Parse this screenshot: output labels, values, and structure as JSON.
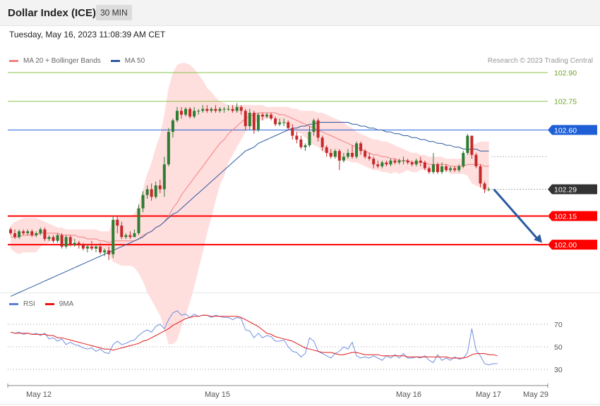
{
  "header": {
    "title": "Dollar Index (ICE)",
    "timeframe": "30 MIN"
  },
  "date": "Tuesday, May 16, 2023 11:08:39 AM CET",
  "legend": {
    "ma20": "MA 20 + Bollinger Bands",
    "ma50": "MA 50",
    "credit": "Research © 2023 Trading Central"
  },
  "rsi_legend": {
    "rsi": "RSI",
    "ma9": "9MA"
  },
  "colors": {
    "up": "#2e7d32",
    "down": "#c62828",
    "band_fill": "#ffdede",
    "ma20": "#f08080",
    "ma50": "#2c5aa0",
    "support": "#ff0000",
    "resistance": "#8bc34a",
    "pivot": "#1f5fd6",
    "arrow": "#2c5aa0"
  },
  "chart_data": {
    "type": "candlestick",
    "price_axis": {
      "ylim": [
        101.68,
        102.97
      ]
    },
    "x_labels": [
      "May 12",
      "May 15",
      "May 16",
      "May 17",
      "May 29"
    ],
    "levels": [
      {
        "value": 102.9,
        "label": "102.90",
        "kind": "resistance"
      },
      {
        "value": 102.75,
        "label": "102.75",
        "kind": "resistance"
      },
      {
        "value": 102.6,
        "label": "102.60",
        "kind": "pivot"
      },
      {
        "value": 102.29,
        "label": "102.29",
        "kind": "last"
      },
      {
        "value": 102.15,
        "label": "102.15",
        "kind": "support"
      },
      {
        "value": 102.0,
        "label": "102.00",
        "kind": "support"
      }
    ],
    "forecast_arrow": {
      "from": 102.29,
      "to": 102.01
    },
    "candles": [
      [
        102.08,
        102.06,
        102.09,
        102.05
      ],
      [
        102.06,
        102.04,
        102.08,
        102.03
      ],
      [
        102.04,
        102.07,
        102.08,
        102.03
      ],
      [
        102.07,
        102.06,
        102.08,
        102.05
      ],
      [
        102.06,
        102.07,
        102.08,
        102.05
      ],
      [
        102.07,
        102.05,
        102.08,
        102.04
      ],
      [
        102.05,
        102.06,
        102.07,
        102.04
      ],
      [
        102.06,
        102.08,
        102.09,
        102.05
      ],
      [
        102.08,
        102.03,
        102.09,
        102.02
      ],
      [
        102.03,
        102.04,
        102.05,
        102.02
      ],
      [
        102.04,
        102.02,
        102.05,
        102.01
      ],
      [
        102.02,
        102.05,
        102.06,
        102.01
      ],
      [
        102.05,
        101.99,
        102.06,
        101.98
      ],
      [
        101.99,
        102.04,
        102.05,
        101.98
      ],
      [
        102.04,
        102.0,
        102.05,
        101.99
      ],
      [
        102.0,
        102.01,
        102.03,
        101.99
      ],
      [
        102.01,
        102.0,
        102.02,
        101.98
      ],
      [
        102.0,
        101.98,
        102.01,
        101.97
      ],
      [
        101.98,
        101.99,
        102.0,
        101.96
      ],
      [
        101.99,
        101.98,
        102.02,
        101.97
      ],
      [
        101.98,
        101.99,
        102.0,
        101.96
      ],
      [
        101.99,
        101.96,
        102.01,
        101.95
      ],
      [
        101.96,
        101.97,
        101.98,
        101.94
      ],
      [
        101.97,
        101.95,
        101.99,
        101.92
      ],
      [
        101.95,
        102.13,
        102.15,
        101.93
      ],
      [
        102.13,
        102.1,
        102.15,
        102.06
      ],
      [
        102.1,
        102.04,
        102.12,
        102.03
      ],
      [
        102.04,
        102.05,
        102.06,
        102.03
      ],
      [
        102.05,
        102.04,
        102.07,
        102.03
      ],
      [
        102.04,
        102.06,
        102.08,
        102.04
      ],
      [
        102.06,
        102.19,
        102.21,
        102.05
      ],
      [
        102.19,
        102.26,
        102.28,
        102.17
      ],
      [
        102.26,
        102.29,
        102.31,
        102.24
      ],
      [
        102.29,
        102.25,
        102.32,
        102.23
      ],
      [
        102.25,
        102.31,
        102.33,
        102.24
      ],
      [
        102.31,
        102.29,
        102.34,
        102.27
      ],
      [
        102.29,
        102.42,
        102.46,
        102.25
      ],
      [
        102.42,
        102.59,
        102.61,
        102.41
      ],
      [
        102.59,
        102.65,
        102.66,
        102.56
      ],
      [
        102.65,
        102.7,
        102.72,
        102.64
      ],
      [
        102.7,
        102.68,
        102.72,
        102.66
      ],
      [
        102.68,
        102.71,
        102.72,
        102.67
      ],
      [
        102.71,
        102.67,
        102.72,
        102.66
      ],
      [
        102.67,
        102.7,
        102.72,
        102.66
      ],
      [
        102.7,
        102.7,
        102.71,
        102.68
      ],
      [
        102.7,
        102.71,
        102.73,
        102.69
      ],
      [
        102.71,
        102.7,
        102.73,
        102.69
      ],
      [
        102.7,
        102.71,
        102.72,
        102.69
      ],
      [
        102.71,
        102.7,
        102.73,
        102.69
      ],
      [
        102.7,
        102.71,
        102.72,
        102.69
      ],
      [
        102.71,
        102.71,
        102.72,
        102.69
      ],
      [
        102.71,
        102.71,
        102.73,
        102.7
      ],
      [
        102.71,
        102.7,
        102.73,
        102.69
      ],
      [
        102.7,
        102.72,
        102.74,
        102.69
      ],
      [
        102.72,
        102.7,
        102.73,
        102.68
      ],
      [
        102.7,
        102.62,
        102.71,
        102.6
      ],
      [
        102.62,
        102.69,
        102.71,
        102.6
      ],
      [
        102.69,
        102.6,
        102.7,
        102.58
      ],
      [
        102.6,
        102.68,
        102.69,
        102.59
      ],
      [
        102.68,
        102.67,
        102.69,
        102.65
      ],
      [
        102.67,
        102.68,
        102.69,
        102.66
      ],
      [
        102.68,
        102.66,
        102.69,
        102.65
      ],
      [
        102.66,
        102.63,
        102.67,
        102.62
      ],
      [
        102.63,
        102.64,
        102.66,
        102.62
      ],
      [
        102.64,
        102.64,
        102.66,
        102.62
      ],
      [
        102.64,
        102.61,
        102.65,
        102.6
      ],
      [
        102.61,
        102.57,
        102.63,
        102.55
      ],
      [
        102.57,
        102.55,
        102.59,
        102.53
      ],
      [
        102.55,
        102.51,
        102.57,
        102.5
      ],
      [
        102.51,
        102.52,
        102.53,
        102.49
      ],
      [
        102.52,
        102.59,
        102.62,
        102.51
      ],
      [
        102.59,
        102.65,
        102.66,
        102.57
      ],
      [
        102.65,
        102.56,
        102.66,
        102.54
      ],
      [
        102.56,
        102.51,
        102.57,
        102.49
      ],
      [
        102.51,
        102.48,
        102.52,
        102.46
      ],
      [
        102.48,
        102.46,
        102.5,
        102.45
      ],
      [
        102.46,
        102.49,
        102.5,
        102.45
      ],
      [
        102.49,
        102.44,
        102.5,
        102.39
      ],
      [
        102.44,
        102.46,
        102.48,
        102.43
      ],
      [
        102.46,
        102.48,
        102.5,
        102.45
      ],
      [
        102.48,
        102.46,
        102.52,
        102.45
      ],
      [
        102.46,
        102.53,
        102.54,
        102.45
      ],
      [
        102.53,
        102.49,
        102.54,
        102.47
      ],
      [
        102.49,
        102.46,
        102.5,
        102.45
      ],
      [
        102.46,
        102.45,
        102.48,
        102.44
      ],
      [
        102.45,
        102.42,
        102.46,
        102.4
      ],
      [
        102.42,
        102.41,
        102.44,
        102.4
      ],
      [
        102.41,
        102.43,
        102.44,
        102.4
      ],
      [
        102.43,
        102.42,
        102.44,
        102.41
      ],
      [
        102.42,
        102.44,
        102.45,
        102.41
      ],
      [
        102.44,
        102.43,
        102.45,
        102.42
      ],
      [
        102.43,
        102.44,
        102.45,
        102.42
      ],
      [
        102.44,
        102.44,
        102.46,
        102.42
      ],
      [
        102.44,
        102.43,
        102.45,
        102.42
      ],
      [
        102.43,
        102.42,
        102.44,
        102.41
      ],
      [
        102.42,
        102.44,
        102.45,
        102.41
      ],
      [
        102.44,
        102.43,
        102.46,
        102.41
      ],
      [
        102.43,
        102.4,
        102.44,
        102.39
      ],
      [
        102.4,
        102.38,
        102.41,
        102.37
      ],
      [
        102.38,
        102.42,
        102.48,
        102.37
      ],
      [
        102.42,
        102.38,
        102.43,
        102.37
      ],
      [
        102.38,
        102.41,
        102.43,
        102.37
      ],
      [
        102.41,
        102.39,
        102.42,
        102.38
      ],
      [
        102.39,
        102.4,
        102.41,
        102.38
      ],
      [
        102.4,
        102.39,
        102.41,
        102.38
      ],
      [
        102.39,
        102.41,
        102.42,
        102.38
      ],
      [
        102.41,
        102.48,
        102.49,
        102.4
      ],
      [
        102.48,
        102.57,
        102.58,
        102.47
      ],
      [
        102.57,
        102.47,
        102.57,
        102.45
      ],
      [
        102.47,
        102.41,
        102.48,
        102.4
      ],
      [
        102.41,
        102.32,
        102.42,
        102.3
      ],
      [
        102.32,
        102.29,
        102.33,
        102.27
      ],
      [
        102.29,
        102.29,
        102.3,
        102.28
      ]
    ],
    "ma20": [
      102.04,
      102.04,
      102.04,
      102.05,
      102.05,
      102.05,
      102.05,
      102.06,
      102.06,
      102.06,
      102.06,
      102.06,
      102.05,
      102.05,
      102.05,
      102.05,
      102.04,
      102.04,
      102.03,
      102.03,
      102.03,
      102.02,
      102.02,
      102.01,
      102.02,
      102.02,
      102.02,
      102.02,
      102.02,
      102.02,
      102.03,
      102.05,
      102.06,
      102.07,
      102.09,
      102.1,
      102.12,
      102.15,
      102.19,
      102.22,
      102.26,
      102.29,
      102.32,
      102.35,
      102.38,
      102.41,
      102.44,
      102.47,
      102.5,
      102.53,
      102.55,
      102.58,
      102.6,
      102.62,
      102.64,
      102.66,
      102.67,
      102.68,
      102.69,
      102.69,
      102.69,
      102.69,
      102.69,
      102.68,
      102.68,
      102.67,
      102.66,
      102.65,
      102.64,
      102.63,
      102.62,
      102.61,
      102.6,
      102.59,
      102.58,
      102.57,
      102.56,
      102.55,
      102.54,
      102.53,
      102.52,
      102.51,
      102.5,
      102.49,
      102.48,
      102.47,
      102.47,
      102.46,
      102.46,
      102.45,
      102.45,
      102.44,
      102.44,
      102.44,
      102.43,
      102.43,
      102.43,
      102.43,
      102.42,
      102.42,
      102.42,
      102.42,
      102.42,
      102.41,
      102.41,
      102.41,
      102.41,
      102.42,
      102.42,
      102.42,
      102.42,
      102.41,
      102.41
    ],
    "bb_upper": [
      102.1,
      102.12,
      102.13,
      102.14,
      102.14,
      102.14,
      102.14,
      102.13,
      102.12,
      102.11,
      102.1,
      102.09,
      102.09,
      102.08,
      102.08,
      102.08,
      102.08,
      102.08,
      102.08,
      102.08,
      102.08,
      102.07,
      102.07,
      102.07,
      102.13,
      102.14,
      102.15,
      102.15,
      102.15,
      102.16,
      102.21,
      102.29,
      102.37,
      102.43,
      102.51,
      102.57,
      102.68,
      102.82,
      102.9,
      102.94,
      102.95,
      102.95,
      102.94,
      102.92,
      102.89,
      102.86,
      102.82,
      102.8,
      102.77,
      102.75,
      102.74,
      102.73,
      102.73,
      102.73,
      102.73,
      102.73,
      102.73,
      102.73,
      102.73,
      102.73,
      102.72,
      102.72,
      102.72,
      102.72,
      102.72,
      102.72,
      102.71,
      102.71,
      102.7,
      102.7,
      102.7,
      102.7,
      102.69,
      102.69,
      102.68,
      102.67,
      102.66,
      102.65,
      102.64,
      102.62,
      102.61,
      102.59,
      102.58,
      102.57,
      102.56,
      102.55,
      102.55,
      102.54,
      102.54,
      102.53,
      102.52,
      102.51,
      102.5,
      102.49,
      102.48,
      102.48,
      102.47,
      102.47,
      102.46,
      102.46,
      102.46,
      102.46,
      102.45,
      102.45,
      102.45,
      102.45,
      102.45,
      102.48,
      102.52,
      102.53,
      102.54,
      102.54,
      102.54
    ],
    "bb_lower": [
      101.98,
      101.96,
      101.95,
      101.96,
      101.96,
      101.96,
      101.96,
      101.99,
      102.0,
      102.01,
      102.02,
      102.03,
      102.01,
      102.02,
      102.02,
      102.02,
      102.0,
      102.0,
      101.98,
      101.98,
      101.98,
      101.97,
      101.97,
      101.95,
      101.91,
      101.9,
      101.89,
      101.89,
      101.89,
      101.88,
      101.85,
      101.81,
      101.75,
      101.71,
      101.67,
      101.63,
      101.56,
      101.48,
      101.48,
      101.5,
      101.57,
      101.63,
      101.7,
      101.78,
      101.87,
      101.96,
      102.06,
      102.14,
      102.23,
      102.31,
      102.36,
      102.43,
      102.47,
      102.51,
      102.55,
      102.59,
      102.61,
      102.63,
      102.65,
      102.65,
      102.66,
      102.66,
      102.66,
      102.64,
      102.64,
      102.62,
      102.61,
      102.59,
      102.58,
      102.56,
      102.54,
      102.52,
      102.51,
      102.49,
      102.48,
      102.47,
      102.46,
      102.45,
      102.44,
      102.44,
      102.43,
      102.43,
      102.42,
      102.41,
      102.4,
      102.39,
      102.39,
      102.38,
      102.38,
      102.37,
      102.38,
      102.37,
      102.38,
      102.39,
      102.38,
      102.38,
      102.39,
      102.39,
      102.38,
      102.38,
      102.38,
      102.38,
      102.39,
      102.37,
      102.37,
      102.37,
      102.37,
      102.36,
      102.32,
      102.31,
      102.3,
      102.28,
      102.28
    ],
    "ma50": [
      101.73,
      101.74,
      101.75,
      101.76,
      101.77,
      101.78,
      101.79,
      101.8,
      101.81,
      101.82,
      101.83,
      101.84,
      101.85,
      101.86,
      101.87,
      101.88,
      101.89,
      101.9,
      101.91,
      101.92,
      101.93,
      101.94,
      101.95,
      101.96,
      101.97,
      101.98,
      101.99,
      102.0,
      102.01,
      102.02,
      102.03,
      102.04,
      102.06,
      102.07,
      102.09,
      102.1,
      102.12,
      102.14,
      102.16,
      102.17,
      102.19,
      102.21,
      102.23,
      102.25,
      102.27,
      102.29,
      102.31,
      102.33,
      102.35,
      102.37,
      102.39,
      102.41,
      102.43,
      102.45,
      102.47,
      102.49,
      102.5,
      102.51,
      102.53,
      102.54,
      102.55,
      102.56,
      102.57,
      102.58,
      102.59,
      102.6,
      102.61,
      102.61,
      102.62,
      102.62,
      102.63,
      102.63,
      102.64,
      102.64,
      102.64,
      102.64,
      102.64,
      102.64,
      102.64,
      102.64,
      102.63,
      102.63,
      102.62,
      102.62,
      102.61,
      102.61,
      102.6,
      102.6,
      102.59,
      102.59,
      102.58,
      102.58,
      102.57,
      102.57,
      102.56,
      102.56,
      102.55,
      102.55,
      102.54,
      102.54,
      102.53,
      102.53,
      102.52,
      102.52,
      102.51,
      102.51,
      102.5,
      102.5,
      102.5,
      102.5,
      102.49,
      102.49,
      102.49
    ],
    "rsi": {
      "ylim": [
        20,
        80
      ],
      "levels": [
        70,
        50,
        30
      ],
      "rsi": [
        63,
        62,
        63,
        61,
        62,
        61,
        62,
        60,
        62,
        57,
        58,
        55,
        57,
        52,
        54,
        52,
        51,
        49,
        48,
        49,
        46,
        48,
        45,
        44,
        52,
        55,
        52,
        53,
        55,
        56,
        60,
        63,
        65,
        63,
        68,
        70,
        66,
        74,
        80,
        82,
        78,
        79,
        76,
        79,
        77,
        78,
        78,
        76,
        78,
        77,
        76,
        76,
        74,
        76,
        75,
        65,
        64,
        58,
        62,
        58,
        60,
        59,
        55,
        55,
        56,
        50,
        46,
        45,
        41,
        44,
        58,
        55,
        46,
        44,
        42,
        40,
        44,
        46,
        50,
        48,
        54,
        42,
        40,
        41,
        40,
        42,
        40,
        38,
        42,
        40,
        43,
        40,
        44,
        40,
        40,
        41,
        40,
        42,
        38,
        36,
        43,
        38,
        40,
        38,
        41,
        39,
        40,
        45,
        66,
        47,
        42,
        35,
        34,
        35,
        35
      ],
      "ma9": [
        63,
        62,
        62,
        62,
        62,
        61,
        61,
        61,
        61,
        60,
        60,
        58,
        58,
        57,
        56,
        55,
        54,
        53,
        52,
        51,
        50,
        49,
        48,
        48,
        47,
        48,
        49,
        50,
        51,
        52,
        53,
        55,
        56,
        58,
        60,
        62,
        64,
        66,
        69,
        71,
        73,
        75,
        76,
        77,
        77,
        78,
        78,
        77,
        77,
        77,
        77,
        77,
        77,
        77,
        76,
        74,
        72,
        70,
        68,
        65,
        62,
        61,
        59,
        58,
        57,
        56,
        55,
        53,
        51,
        49,
        48,
        47,
        46,
        45,
        45,
        45,
        44,
        43,
        43,
        44,
        45,
        45,
        44,
        43,
        43,
        43,
        43,
        42,
        42,
        42,
        42,
        42,
        42,
        41,
        41,
        41,
        41,
        41,
        41,
        41,
        41,
        41,
        41,
        40,
        40,
        40,
        40,
        41,
        43,
        44,
        44,
        44,
        43,
        43,
        42
      ]
    }
  }
}
